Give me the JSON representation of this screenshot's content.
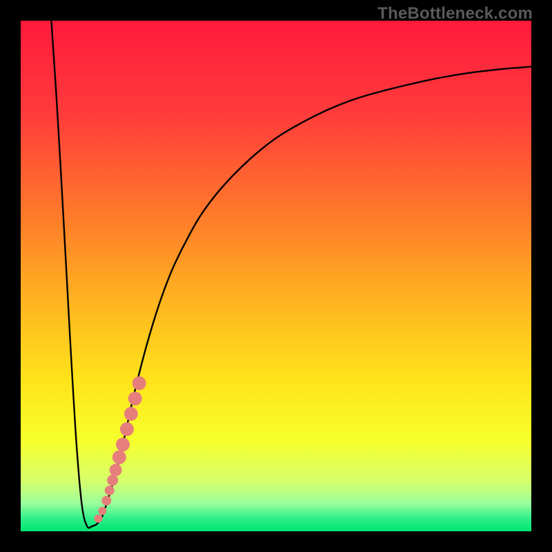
{
  "watermark": "TheBottleneck.com",
  "colors": {
    "frame": "#000000",
    "gradient_stops": [
      {
        "offset": 0.0,
        "color": "#ff1a3c"
      },
      {
        "offset": 0.18,
        "color": "#ff3b3b"
      },
      {
        "offset": 0.38,
        "color": "#ff7a2a"
      },
      {
        "offset": 0.55,
        "color": "#ffb420"
      },
      {
        "offset": 0.7,
        "color": "#ffe21a"
      },
      {
        "offset": 0.82,
        "color": "#f6ff2a"
      },
      {
        "offset": 0.9,
        "color": "#d8ff6a"
      },
      {
        "offset": 0.945,
        "color": "#9cff9c"
      },
      {
        "offset": 0.975,
        "color": "#2ef08a"
      },
      {
        "offset": 1.0,
        "color": "#00e472"
      }
    ],
    "curve": "#000000",
    "markers_fill": "#e67f7c",
    "markers_stroke": "#c76865"
  },
  "chart_data": {
    "type": "line",
    "title": "",
    "xlabel": "",
    "ylabel": "",
    "xlim": [
      0,
      100
    ],
    "ylim": [
      0,
      100
    ],
    "series": [
      {
        "name": "bottleneck-curve",
        "x": [
          6,
          7,
          8,
          9,
          10,
          11,
          12,
          13,
          14,
          15,
          16,
          17,
          18.5,
          20,
          22,
          24,
          26,
          28,
          30,
          33,
          36,
          40,
          45,
          50,
          55,
          60,
          65,
          70,
          76,
          82,
          88,
          94,
          100
        ],
        "y": [
          100,
          85,
          68,
          50,
          32,
          16,
          5,
          1,
          1,
          1.5,
          3,
          6,
          11,
          17,
          26,
          34,
          41,
          47,
          52,
          58,
          63,
          68,
          73,
          77,
          80,
          82.5,
          84.5,
          86,
          87.5,
          88.8,
          89.8,
          90.5,
          91
        ]
      }
    ],
    "markers": {
      "name": "highlighted-points",
      "points": [
        {
          "x": 15.2,
          "y": 2.5,
          "r": 6
        },
        {
          "x": 16.0,
          "y": 4.0,
          "r": 6
        },
        {
          "x": 16.8,
          "y": 6.0,
          "r": 7
        },
        {
          "x": 17.4,
          "y": 8.0,
          "r": 7
        },
        {
          "x": 18.0,
          "y": 10.0,
          "r": 8
        },
        {
          "x": 18.6,
          "y": 12.0,
          "r": 9
        },
        {
          "x": 19.3,
          "y": 14.5,
          "r": 10
        },
        {
          "x": 20.0,
          "y": 17.0,
          "r": 10
        },
        {
          "x": 20.8,
          "y": 20.0,
          "r": 10
        },
        {
          "x": 21.6,
          "y": 23.0,
          "r": 10
        },
        {
          "x": 22.4,
          "y": 26.0,
          "r": 10
        },
        {
          "x": 23.2,
          "y": 29.0,
          "r": 10
        }
      ]
    }
  }
}
